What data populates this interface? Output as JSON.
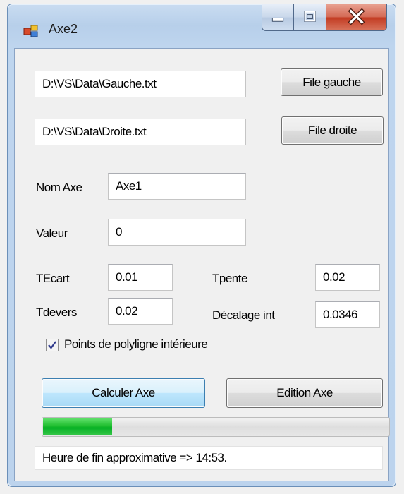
{
  "window": {
    "title": "Axe2",
    "minimize_icon": "minimize-icon",
    "maximize_icon": "maximize-icon",
    "close_icon": "close-icon",
    "app_icon": "form-app-icon"
  },
  "files": {
    "gauche_path": "D:\\VS\\Data\\Gauche.txt",
    "gauche_button": "File gauche",
    "droite_path": "D:\\VS\\Data\\Droite.txt",
    "droite_button": "File droite"
  },
  "fields": {
    "nom_axe_label": "Nom Axe",
    "nom_axe_value": "Axe1",
    "valeur_label": "Valeur",
    "valeur_value": "0",
    "tecart_label": "TEcart",
    "tecart_value": "0.01",
    "tpente_label": "Tpente",
    "tpente_value": "0.02",
    "tdevers_label": "Tdevers",
    "tdevers_value": "0.02",
    "decalage_label": "Décalage int",
    "decalage_value": "0.0346"
  },
  "checkbox": {
    "label": "Points de polyligne intérieure",
    "checked": true
  },
  "actions": {
    "calculer": "Calculer Axe",
    "edition": "Edition Axe"
  },
  "progress": {
    "fraction": 0.2
  },
  "status": {
    "text": "Heure de fin approximative => 14:53."
  }
}
